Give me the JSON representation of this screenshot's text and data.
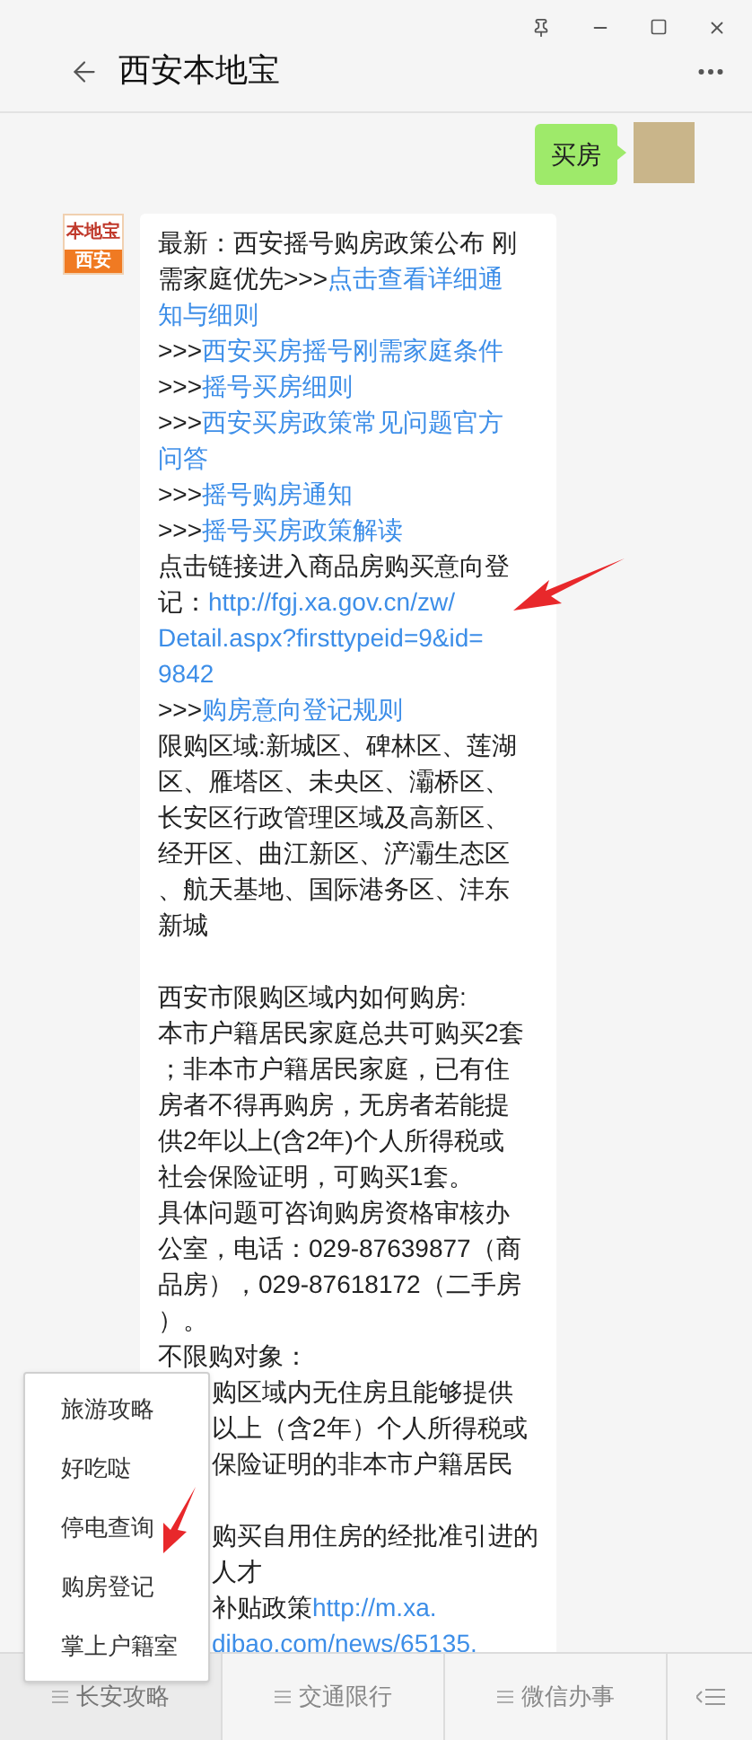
{
  "window": {
    "title": "西安本地宝"
  },
  "messages": [
    {
      "kind": "sent",
      "text": "买房"
    },
    {
      "kind": "received",
      "logo": {
        "brand": "本地宝",
        "city": "西安"
      },
      "lines": [
        {
          "kind": "full",
          "segments": [
            {
              "text": "最新：西安摇号购房政策公布 刚",
              "link": false
            }
          ]
        },
        {
          "kind": "full",
          "segments": [
            {
              "text": "需家庭优先>>>",
              "link": false
            },
            {
              "text": "点击查看详细通",
              "link": true
            }
          ]
        },
        {
          "kind": "full",
          "segments": [
            {
              "text": "知与细则",
              "link": true
            }
          ]
        },
        {
          "kind": "full",
          "segments": [
            {
              "text": ">>>",
              "link": false
            },
            {
              "text": "西安买房摇号刚需家庭条件",
              "link": true
            }
          ]
        },
        {
          "kind": "full",
          "segments": [
            {
              "text": ">>>",
              "link": false
            },
            {
              "text": "摇号买房细则",
              "link": true
            }
          ]
        },
        {
          "kind": "full",
          "segments": [
            {
              "text": ">>>",
              "link": false
            },
            {
              "text": "西安买房政策常见问题官方",
              "link": true
            }
          ]
        },
        {
          "kind": "full",
          "segments": [
            {
              "text": "问答",
              "link": true
            }
          ]
        },
        {
          "kind": "full",
          "segments": [
            {
              "text": ">>>",
              "link": false
            },
            {
              "text": "摇号购房通知",
              "link": true
            }
          ]
        },
        {
          "kind": "full",
          "segments": [
            {
              "text": ">>>",
              "link": false
            },
            {
              "text": "摇号买房政策解读",
              "link": true
            }
          ]
        },
        {
          "kind": "full",
          "segments": [
            {
              "text": "点击链接进入商品房购买意向登",
              "link": false
            }
          ]
        },
        {
          "kind": "full",
          "segments": [
            {
              "text": "记：",
              "link": false
            },
            {
              "text": "http://fgj.xa.gov.cn/zw/",
              "link": true
            }
          ]
        },
        {
          "kind": "full",
          "segments": [
            {
              "text": "Detail.aspx?firsttypeid=9&id=",
              "link": true
            }
          ]
        },
        {
          "kind": "full",
          "segments": [
            {
              "text": "9842",
              "link": true
            }
          ]
        },
        {
          "kind": "full",
          "segments": [
            {
              "text": ">>>",
              "link": false
            },
            {
              "text": "购房意向登记规则",
              "link": true
            }
          ]
        },
        {
          "kind": "full",
          "segments": [
            {
              "text": "限购区域:新城区、碑林区、莲湖",
              "link": false
            }
          ]
        },
        {
          "kind": "full",
          "segments": [
            {
              "text": "区、雁塔区、未央区、灞桥区、",
              "link": false
            }
          ]
        },
        {
          "kind": "full",
          "segments": [
            {
              "text": "长安区行政管理区域及高新区、",
              "link": false
            }
          ]
        },
        {
          "kind": "full",
          "segments": [
            {
              "text": "经开区、曲江新区、浐灞生态区",
              "link": false
            }
          ]
        },
        {
          "kind": "full",
          "segments": [
            {
              "text": "、航天基地、国际港务区、沣东",
              "link": false
            }
          ]
        },
        {
          "kind": "full",
          "segments": [
            {
              "text": "新城",
              "link": false
            }
          ]
        },
        {
          "kind": "blank"
        },
        {
          "kind": "full",
          "segments": [
            {
              "text": "西安市限购区域内如何购房:",
              "link": false
            }
          ]
        },
        {
          "kind": "full",
          "segments": [
            {
              "text": "本市户籍居民家庭总共可购买2套",
              "link": false
            }
          ]
        },
        {
          "kind": "full",
          "segments": [
            {
              "text": "；非本市户籍居民家庭，已有住",
              "link": false
            }
          ]
        },
        {
          "kind": "full",
          "segments": [
            {
              "text": "房者不得再购房，无房者若能提",
              "link": false
            }
          ]
        },
        {
          "kind": "full",
          "segments": [
            {
              "text": "供2年以上(含2年)个人所得税或",
              "link": false
            }
          ]
        },
        {
          "kind": "full",
          "segments": [
            {
              "text": "社会保险证明，可购买1套。",
              "link": false
            }
          ]
        },
        {
          "kind": "full",
          "segments": [
            {
              "text": "具体问题可咨询购房资格审核办",
              "link": false
            }
          ]
        },
        {
          "kind": "full",
          "segments": [
            {
              "text": "公室，电话：029-87639877（商",
              "link": false
            }
          ]
        },
        {
          "kind": "full",
          "segments": [
            {
              "text": "品房），029-87618172（二手房",
              "link": false
            }
          ]
        },
        {
          "kind": "full",
          "segments": [
            {
              "text": "）。",
              "link": false
            }
          ]
        },
        {
          "kind": "full",
          "segments": [
            {
              "text": "不限购对象：",
              "link": false
            }
          ]
        },
        {
          "kind": "partial",
          "segments": [
            {
              "text": "购区域内无住房且能够提供",
              "link": false
            }
          ]
        },
        {
          "kind": "partial",
          "segments": [
            {
              "text": "以上（含2年）个人所得税或",
              "link": false
            }
          ]
        },
        {
          "kind": "partial",
          "segments": [
            {
              "text": "保险证明的非本市户籍居民",
              "link": false
            }
          ]
        },
        {
          "kind": "blank"
        },
        {
          "kind": "partial",
          "segments": [
            {
              "text": "购买自用住房的经批准引进的",
              "link": false
            }
          ]
        },
        {
          "kind": "partial",
          "segments": [
            {
              "text": "人才",
              "link": false
            }
          ]
        },
        {
          "kind": "partial",
          "segments": [
            {
              "text": "补贴政策",
              "link": false
            },
            {
              "text": "http://m.xa.",
              "link": true
            }
          ]
        },
        {
          "kind": "partial",
          "segments": [
            {
              "text": "dibao.com/news/65135.",
              "link": true
            }
          ]
        }
      ]
    }
  ],
  "popup_menu": {
    "items": [
      "旅游攻略",
      "好吃哒",
      "停电查询",
      "购房登记",
      "掌上户籍室"
    ]
  },
  "bottom_menu": {
    "items": [
      {
        "label": "长安攻略",
        "selected": true
      },
      {
        "label": "交通限行",
        "selected": false
      },
      {
        "label": "微信办事",
        "selected": false
      }
    ]
  }
}
